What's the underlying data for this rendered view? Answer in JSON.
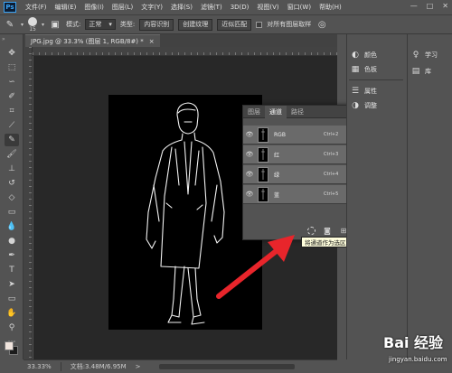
{
  "menubar": {
    "logo": "Ps",
    "items": [
      "文件(F)",
      "编辑(E)",
      "图像(I)",
      "图层(L)",
      "文字(Y)",
      "选择(S)",
      "滤镜(T)",
      "3D(D)",
      "视图(V)",
      "窗口(W)",
      "帮助(H)"
    ],
    "window_controls": [
      "—",
      "□",
      "✕"
    ]
  },
  "options": {
    "brush_size": "15",
    "mode_label": "模式:",
    "mode_value": "正常",
    "type_label": "类型:",
    "type_buttons": [
      "内容识别",
      "创建纹理",
      "近似匹配"
    ],
    "sample_all_label": "对所有图层取样"
  },
  "document": {
    "tab_title": "JPG.jpg @ 33.3% (图层 1, RGB/8#) *",
    "tab_close": "×"
  },
  "status": {
    "zoom": "33.33%",
    "doc_info": "文档:3.48M/6.95M",
    "arrow": ">"
  },
  "panels": {
    "group1": [
      {
        "icon": "color-icon",
        "glyph": "◐",
        "label": "颜色"
      },
      {
        "icon": "swatches-icon",
        "glyph": "▦",
        "label": "色板"
      }
    ],
    "group2": [
      {
        "icon": "properties-icon",
        "glyph": "☰",
        "label": "属性"
      },
      {
        "icon": "adjustments-icon",
        "glyph": "◑",
        "label": "调整"
      }
    ],
    "col2": [
      {
        "icon": "learn-icon",
        "glyph": "♀",
        "label": "学习"
      },
      {
        "icon": "libraries-icon",
        "glyph": "▤",
        "label": "库"
      }
    ]
  },
  "channels_panel": {
    "tabs": [
      "图层",
      "通道",
      "路径"
    ],
    "active_tab": "通道",
    "menu": "≡",
    "rows": [
      {
        "name": "RGB",
        "shortcut": "Ctrl+2"
      },
      {
        "name": "红",
        "shortcut": "Ctrl+3"
      },
      {
        "name": "绿",
        "shortcut": "Ctrl+4"
      },
      {
        "name": "蓝",
        "shortcut": "Ctrl+5"
      }
    ],
    "tooltip": "将通道作为选区载入"
  },
  "watermark": {
    "brand": "Bai 经验",
    "url": "jingyan.baidu.com"
  },
  "colors": {
    "ui_bg": "#535353",
    "canvas_area": "#282828",
    "arrow_red": "#e8252b",
    "foreground_swatch": "#f0e4dd",
    "background_swatch": "#1b1b1b"
  }
}
